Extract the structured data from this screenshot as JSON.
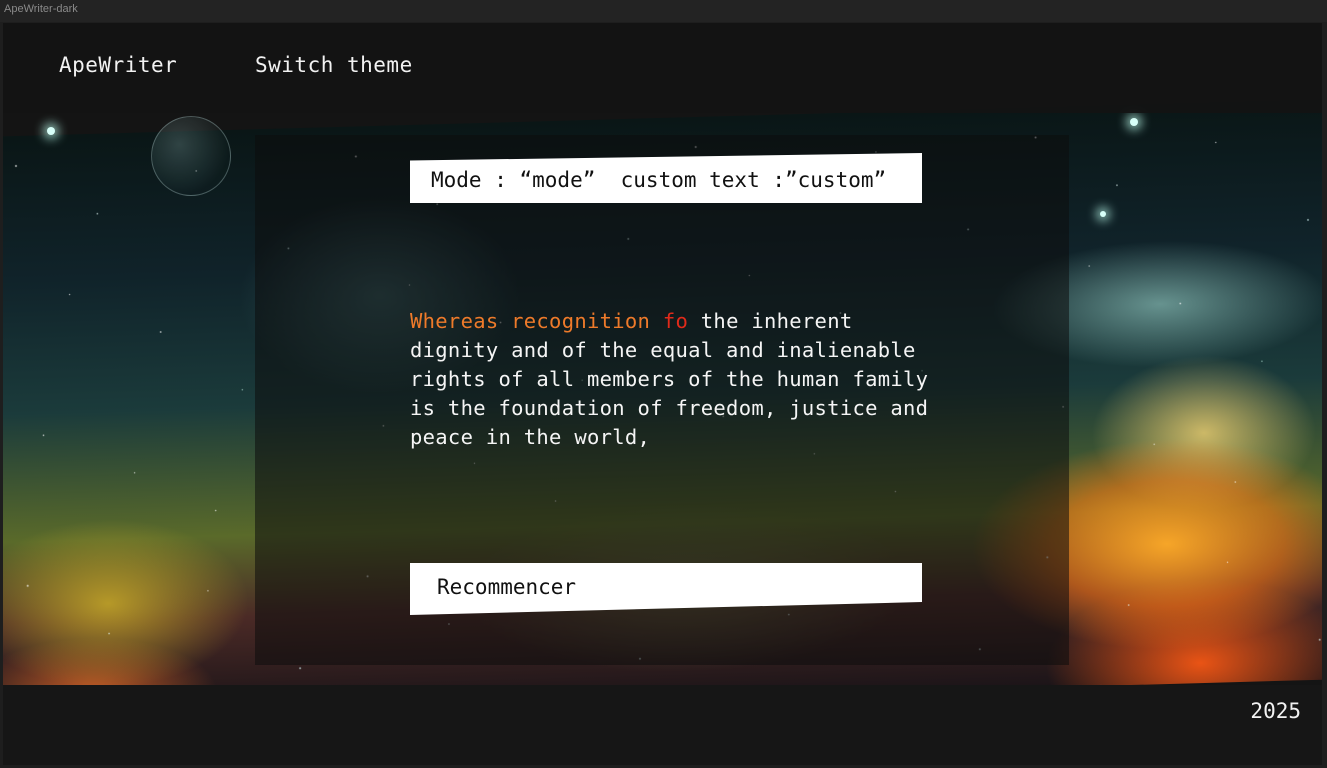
{
  "window": {
    "title": "ApeWriter-dark"
  },
  "header": {
    "brand": "ApeWriter",
    "switch_theme_label": "Switch theme"
  },
  "mode_bar": {
    "text": "Mode : “mode”  custom text :”custom”"
  },
  "passage": {
    "typed_text": "Whereas recognition ",
    "error_text": "fo",
    "remaining_text": " the inherent dignity and of the equal and inalienable rights of all members of the human family is the foundation  of freedom, justice and peace in the world,"
  },
  "start_button": {
    "label": "Recommencer"
  },
  "footer": {
    "year": "2025"
  },
  "colors": {
    "typed": "#ee7a2a",
    "error": "#e02a1a",
    "text": "#f5f5f5",
    "background": "#141414"
  },
  "background_image": "night-sky-reflection"
}
